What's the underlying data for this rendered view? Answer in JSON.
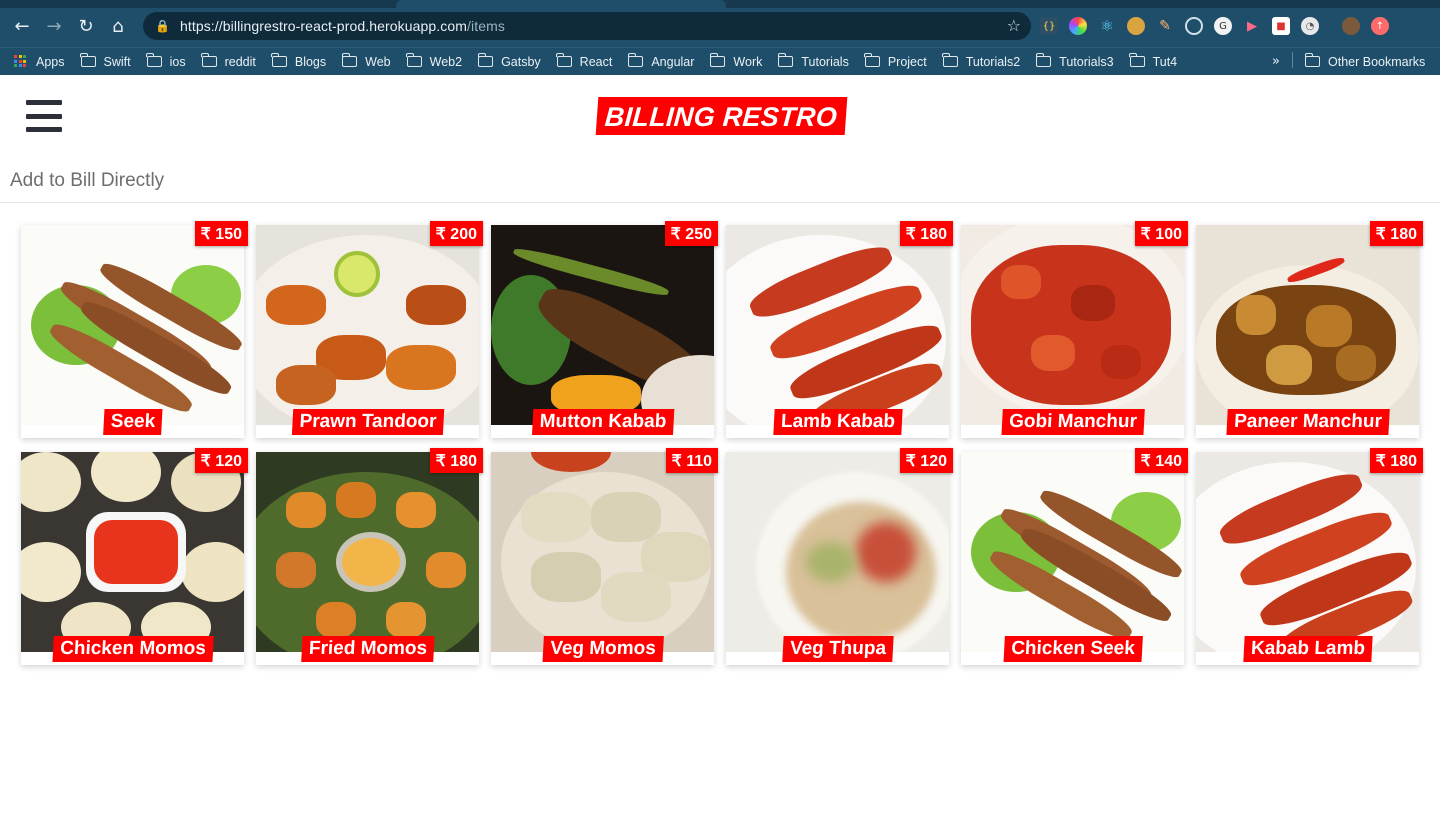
{
  "browser": {
    "url_host": "https://billingrestro-react-prod.herokuapp.com",
    "url_path": "/items",
    "bookmarks": [
      "Apps",
      "Swift",
      "ios",
      "reddit",
      "Blogs",
      "Web",
      "Web2",
      "Gatsby",
      "React",
      "Angular",
      "Work",
      "Tutorials",
      "Project",
      "Tutorials2",
      "Tutorials3",
      "Tut4"
    ],
    "more_label": "»",
    "other_bookmarks": "Other Bookmarks"
  },
  "app": {
    "brand": "BILLING RESTRO",
    "subtitle": "Add to Bill Directly"
  },
  "items": [
    {
      "name": "Seek",
      "price": "₹ 150"
    },
    {
      "name": "Prawn Tandoor",
      "price": "₹ 200"
    },
    {
      "name": "Mutton Kabab",
      "price": "₹ 250"
    },
    {
      "name": "Lamb Kabab",
      "price": "₹ 180"
    },
    {
      "name": "Gobi Manchur",
      "price": "₹ 100"
    },
    {
      "name": "Paneer Manchur",
      "price": "₹ 180"
    },
    {
      "name": "Chicken Momos",
      "price": "₹ 120"
    },
    {
      "name": "Fried Momos",
      "price": "₹ 180"
    },
    {
      "name": "Veg Momos",
      "price": "₹ 110"
    },
    {
      "name": "Veg Thupa",
      "price": "₹ 120"
    },
    {
      "name": "Chicken Seek",
      "price": "₹ 140"
    },
    {
      "name": "Kabab Lamb",
      "price": "₹ 180"
    }
  ]
}
